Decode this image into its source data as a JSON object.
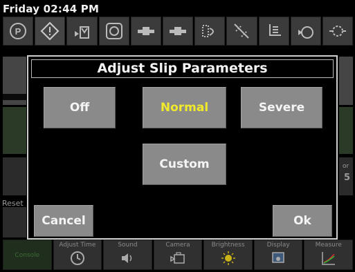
{
  "status": {
    "clock": "Friday 02:44 PM"
  },
  "icon_bar": [
    {
      "icon": "park-brake-icon"
    },
    {
      "icon": "warning-icon"
    },
    {
      "icon": "engine-hitch-icon"
    },
    {
      "icon": "gauge-icon"
    },
    {
      "icon": "hydraulic-valve-icon"
    },
    {
      "icon": "hydraulic-valve-2-icon"
    },
    {
      "icon": "flow-icon"
    },
    {
      "icon": "slip-icon"
    },
    {
      "icon": "hitch-lower-icon"
    },
    {
      "icon": "rear-view-icon"
    },
    {
      "icon": "pto-icon"
    }
  ],
  "background": {
    "reset_label": "Reset",
    "side_char": "5",
    "side_label": "or"
  },
  "bottom_bar": [
    {
      "label": "Console",
      "icon": "console-icon"
    },
    {
      "label": "Adjust Time",
      "icon": "clock-icon"
    },
    {
      "label": "Sound",
      "icon": "speaker-icon"
    },
    {
      "label": "Camera",
      "icon": "camera-icon"
    },
    {
      "label": "Brightness",
      "icon": "sun-icon"
    },
    {
      "label": "Display",
      "icon": "display-icon"
    },
    {
      "label": "Measure",
      "icon": "graph-icon"
    }
  ],
  "modal": {
    "title": "Adjust Slip Parameters",
    "options": {
      "off": "Off",
      "normal": "Normal",
      "severe": "Severe",
      "custom": "Custom"
    },
    "selected": "Normal",
    "cancel": "Cancel",
    "ok": "Ok"
  },
  "colors": {
    "background": "#000000",
    "button": "#8a8a8a",
    "selected_text": "#f0ea2a",
    "text": "#f4f4f4"
  }
}
